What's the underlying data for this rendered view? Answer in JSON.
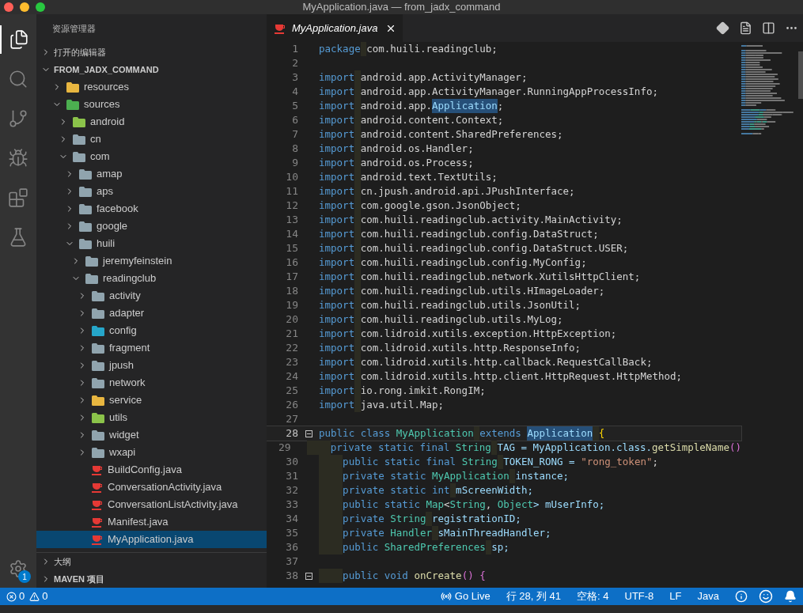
{
  "window": {
    "title": "MyApplication.java — from_jadx_command"
  },
  "activity_bar": {
    "items": [
      {
        "kind": "files",
        "selected": true
      },
      {
        "kind": "search",
        "selected": false
      },
      {
        "kind": "git",
        "selected": false
      },
      {
        "kind": "debug",
        "selected": false
      },
      {
        "kind": "extensions",
        "selected": false
      },
      {
        "kind": "flask",
        "selected": false
      }
    ],
    "settings_badge": "1"
  },
  "sidebar": {
    "title": "资源管理器",
    "sections": [
      {
        "label": "打开的编辑器",
        "expanded": false,
        "bold": false
      },
      {
        "label": "FROM_JADX_COMMAND",
        "expanded": true,
        "bold": true
      }
    ],
    "tree": [
      {
        "kind": "folder",
        "label": "resources",
        "color": "#e8b640",
        "expanded": false,
        "selected": false
      },
      {
        "kind": "folder",
        "label": "sources",
        "color": "#4caf50",
        "expanded": true,
        "selected": false,
        "children": [
          {
            "kind": "folder",
            "label": "android",
            "color": "#8bc34a",
            "expanded": false,
            "selected": false
          },
          {
            "kind": "folder",
            "label": "cn",
            "color": "#90a4ae",
            "expanded": false,
            "selected": false
          },
          {
            "kind": "folder",
            "label": "com",
            "color": "#90a4ae",
            "expanded": true,
            "selected": false,
            "children": [
              {
                "kind": "folder",
                "label": "amap",
                "color": "#90a4ae",
                "expanded": false,
                "selected": false
              },
              {
                "kind": "folder",
                "label": "aps",
                "color": "#90a4ae",
                "expanded": false,
                "selected": false
              },
              {
                "kind": "folder",
                "label": "facebook",
                "color": "#90a4ae",
                "expanded": false,
                "selected": false
              },
              {
                "kind": "folder",
                "label": "google",
                "color": "#90a4ae",
                "expanded": false,
                "selected": false
              },
              {
                "kind": "folder",
                "label": "huili",
                "color": "#90a4ae",
                "expanded": true,
                "selected": false,
                "children": [
                  {
                    "kind": "folder",
                    "label": "jeremyfeinstein",
                    "color": "#90a4ae",
                    "expanded": false,
                    "selected": false
                  },
                  {
                    "kind": "folder",
                    "label": "readingclub",
                    "color": "#90a4ae",
                    "expanded": true,
                    "selected": false,
                    "children": [
                      {
                        "kind": "folder",
                        "label": "activity",
                        "color": "#90a4ae",
                        "expanded": false,
                        "selected": false
                      },
                      {
                        "kind": "folder",
                        "label": "adapter",
                        "color": "#90a4ae",
                        "expanded": false,
                        "selected": false
                      },
                      {
                        "kind": "folder",
                        "label": "config",
                        "color": "#26a6c9",
                        "expanded": false,
                        "selected": false
                      },
                      {
                        "kind": "folder",
                        "label": "fragment",
                        "color": "#90a4ae",
                        "expanded": false,
                        "selected": false
                      },
                      {
                        "kind": "folder",
                        "label": "jpush",
                        "color": "#90a4ae",
                        "expanded": false,
                        "selected": false
                      },
                      {
                        "kind": "folder",
                        "label": "network",
                        "color": "#90a4ae",
                        "expanded": false,
                        "selected": false
                      },
                      {
                        "kind": "folder",
                        "label": "service",
                        "color": "#e8b640",
                        "expanded": false,
                        "selected": false
                      },
                      {
                        "kind": "folder",
                        "label": "utils",
                        "color": "#8bc34a",
                        "expanded": false,
                        "selected": false
                      },
                      {
                        "kind": "folder",
                        "label": "widget",
                        "color": "#90a4ae",
                        "expanded": false,
                        "selected": false
                      },
                      {
                        "kind": "folder",
                        "label": "wxapi",
                        "color": "#90a4ae",
                        "expanded": false,
                        "selected": false
                      },
                      {
                        "kind": "file",
                        "label": "BuildConfig.java",
                        "selected": false
                      },
                      {
                        "kind": "file",
                        "label": "ConversationActivity.java",
                        "selected": false
                      },
                      {
                        "kind": "file",
                        "label": "ConversationListActivity.java",
                        "selected": false
                      },
                      {
                        "kind": "file",
                        "label": "Manifest.java",
                        "selected": false
                      },
                      {
                        "kind": "file",
                        "label": "MyApplication.java",
                        "selected": true
                      }
                    ]
                  }
                ]
              }
            ]
          }
        ]
      }
    ],
    "bottom_sections": [
      {
        "label": "大纲",
        "expanded": false
      },
      {
        "label": "MAVEN 项目",
        "expanded": false
      }
    ]
  },
  "tabs": [
    {
      "label": "MyApplication.java",
      "selected": true
    }
  ],
  "editor": {
    "lines": [
      {
        "number": "1",
        "foldable": false,
        "current": false,
        "tokens": [
          {
            "kind": "kw",
            "text": "package"
          },
          {
            "kind": "plain",
            "text": " com.huili.readingclub;"
          }
        ]
      },
      {
        "number": "2",
        "foldable": false,
        "current": false
      },
      {
        "number": "3",
        "foldable": false,
        "current": false,
        "tokens": [
          {
            "kind": "kw",
            "text": "import"
          },
          {
            "kind": "plain",
            "text": " android.app.ActivityManager;"
          }
        ]
      },
      {
        "number": "4",
        "foldable": false,
        "current": false,
        "tokens": [
          {
            "kind": "kw",
            "text": "import"
          },
          {
            "kind": "plain",
            "text": " android.app.ActivityManager.RunningAppProcessInfo;"
          }
        ]
      },
      {
        "number": "5",
        "foldable": false,
        "current": false,
        "tokens": [
          {
            "kind": "kw",
            "text": "import"
          },
          {
            "kind": "plain",
            "text": " android.app."
          },
          {
            "kind": "match",
            "text": "Application"
          },
          {
            "kind": "plain",
            "text": ";"
          }
        ]
      },
      {
        "number": "6",
        "foldable": false,
        "current": false,
        "tokens": [
          {
            "kind": "kw",
            "text": "import"
          },
          {
            "kind": "plain",
            "text": " android.content.Context;"
          }
        ]
      },
      {
        "number": "7",
        "foldable": false,
        "current": false,
        "tokens": [
          {
            "kind": "kw",
            "text": "import"
          },
          {
            "kind": "plain",
            "text": " android.content.SharedPreferences;"
          }
        ]
      },
      {
        "number": "8",
        "foldable": false,
        "current": false,
        "tokens": [
          {
            "kind": "kw",
            "text": "import"
          },
          {
            "kind": "plain",
            "text": " android.os.Handler;"
          }
        ]
      },
      {
        "number": "9",
        "foldable": false,
        "current": false,
        "tokens": [
          {
            "kind": "kw",
            "text": "import"
          },
          {
            "kind": "plain",
            "text": " android.os.Process;"
          }
        ]
      },
      {
        "number": "10",
        "foldable": false,
        "current": false,
        "tokens": [
          {
            "kind": "kw",
            "text": "import"
          },
          {
            "kind": "plain",
            "text": " android.text.TextUtils;"
          }
        ]
      },
      {
        "number": "11",
        "foldable": false,
        "current": false,
        "tokens": [
          {
            "kind": "kw",
            "text": "import"
          },
          {
            "kind": "plain",
            "text": " cn.jpush.android.api.JPushInterface;"
          }
        ]
      },
      {
        "number": "12",
        "foldable": false,
        "current": false,
        "tokens": [
          {
            "kind": "kw",
            "text": "import"
          },
          {
            "kind": "plain",
            "text": " com.google.gson.JsonObject;"
          }
        ]
      },
      {
        "number": "13",
        "foldable": false,
        "current": false,
        "tokens": [
          {
            "kind": "kw",
            "text": "import"
          },
          {
            "kind": "plain",
            "text": " com.huili.readingclub.activity.MainActivity;"
          }
        ]
      },
      {
        "number": "14",
        "foldable": false,
        "current": false,
        "tokens": [
          {
            "kind": "kw",
            "text": "import"
          },
          {
            "kind": "plain",
            "text": " com.huili.readingclub.config.DataStruct;"
          }
        ]
      },
      {
        "number": "15",
        "foldable": false,
        "current": false,
        "tokens": [
          {
            "kind": "kw",
            "text": "import"
          },
          {
            "kind": "plain",
            "text": " com.huili.readingclub.config.DataStruct.USER;"
          }
        ]
      },
      {
        "number": "16",
        "foldable": false,
        "current": false,
        "tokens": [
          {
            "kind": "kw",
            "text": "import"
          },
          {
            "kind": "plain",
            "text": " com.huili.readingclub.config.MyConfig;"
          }
        ]
      },
      {
        "number": "17",
        "foldable": false,
        "current": false,
        "tokens": [
          {
            "kind": "kw",
            "text": "import"
          },
          {
            "kind": "plain",
            "text": " com.huili.readingclub.network.XutilsHttpClient;"
          }
        ]
      },
      {
        "number": "18",
        "foldable": false,
        "current": false,
        "tokens": [
          {
            "kind": "kw",
            "text": "import"
          },
          {
            "kind": "plain",
            "text": " com.huili.readingclub.utils.HImageLoader;"
          }
        ]
      },
      {
        "number": "19",
        "foldable": false,
        "current": false,
        "tokens": [
          {
            "kind": "kw",
            "text": "import"
          },
          {
            "kind": "plain",
            "text": " com.huili.readingclub.utils.JsonUtil;"
          }
        ]
      },
      {
        "number": "20",
        "foldable": false,
        "current": false,
        "tokens": [
          {
            "kind": "kw",
            "text": "import"
          },
          {
            "kind": "plain",
            "text": " com.huili.readingclub.utils.MyLog;"
          }
        ]
      },
      {
        "number": "21",
        "foldable": false,
        "current": false,
        "tokens": [
          {
            "kind": "kw",
            "text": "import"
          },
          {
            "kind": "plain",
            "text": " com.lidroid.xutils.exception.HttpException;"
          }
        ]
      },
      {
        "number": "22",
        "foldable": false,
        "current": false,
        "tokens": [
          {
            "kind": "kw",
            "text": "import"
          },
          {
            "kind": "plain",
            "text": " com.lidroid.xutils.http.ResponseInfo;"
          }
        ]
      },
      {
        "number": "23",
        "foldable": false,
        "current": false,
        "tokens": [
          {
            "kind": "kw",
            "text": "import"
          },
          {
            "kind": "plain",
            "text": " com.lidroid.xutils.http.callback.RequestCallBack;"
          }
        ]
      },
      {
        "number": "24",
        "foldable": false,
        "current": false,
        "tokens": [
          {
            "kind": "kw",
            "text": "import"
          },
          {
            "kind": "plain",
            "text": " com.lidroid.xutils.http.client.HttpRequest.HttpMethod;"
          }
        ]
      },
      {
        "number": "25",
        "foldable": false,
        "current": false,
        "tokens": [
          {
            "kind": "kw",
            "text": "import"
          },
          {
            "kind": "plain",
            "text": " io.rong.imkit.RongIM;"
          }
        ]
      },
      {
        "number": "26",
        "foldable": false,
        "current": false,
        "tokens": [
          {
            "kind": "kw",
            "text": "import"
          },
          {
            "kind": "plain",
            "text": " java.util.Map;"
          }
        ]
      },
      {
        "number": "27",
        "foldable": false,
        "current": false
      },
      {
        "number": "28",
        "foldable": true,
        "current": true,
        "tokens": [
          {
            "kind": "kw",
            "text": "public class "
          },
          {
            "kind": "type",
            "text": "MyApplication"
          },
          {
            "kind": "kw",
            "text": " extends "
          },
          {
            "kind": "match",
            "text": "Application"
          },
          {
            "kind": "brace",
            "text": " {"
          }
        ]
      },
      {
        "number": "29",
        "foldable": false,
        "current": false,
        "tokens": [
          {
            "kind": "kw",
            "text": "    private static final "
          },
          {
            "kind": "type",
            "text": "String"
          },
          {
            "kind": "var",
            "text": " TAG = MyApplication.class."
          },
          {
            "kind": "fn",
            "text": "getSimpleName"
          },
          {
            "kind": "paren",
            "text": "()"
          }
        ]
      },
      {
        "number": "30",
        "foldable": false,
        "current": false,
        "tokens": [
          {
            "kind": "kw",
            "text": "    public static final "
          },
          {
            "kind": "type",
            "text": "String"
          },
          {
            "kind": "var",
            "text": " TOKEN_RONG = "
          },
          {
            "kind": "str",
            "text": "\"rong_token\""
          },
          {
            "kind": "plain",
            "text": ";"
          }
        ]
      },
      {
        "number": "31",
        "foldable": false,
        "current": false,
        "tokens": [
          {
            "kind": "kw",
            "text": "    private static "
          },
          {
            "kind": "type",
            "text": "MyApplication"
          },
          {
            "kind": "var",
            "text": " instance;"
          }
        ]
      },
      {
        "number": "32",
        "foldable": false,
        "current": false,
        "tokens": [
          {
            "kind": "kw",
            "text": "    private static int"
          },
          {
            "kind": "var",
            "text": " mScreenWidth;"
          }
        ]
      },
      {
        "number": "33",
        "foldable": false,
        "current": false,
        "tokens": [
          {
            "kind": "kw",
            "text": "    public static "
          },
          {
            "kind": "type",
            "text": "Map"
          },
          {
            "kind": "plain",
            "text": "<"
          },
          {
            "kind": "type",
            "text": "String"
          },
          {
            "kind": "plain",
            "text": ", "
          },
          {
            "kind": "type",
            "text": "Object"
          },
          {
            "kind": "var",
            "text": "> mUserInfo;"
          }
        ]
      },
      {
        "number": "34",
        "foldable": false,
        "current": false,
        "tokens": [
          {
            "kind": "kw",
            "text": "    private "
          },
          {
            "kind": "type",
            "text": "String"
          },
          {
            "kind": "var",
            "text": " registrationID;"
          }
        ]
      },
      {
        "number": "35",
        "foldable": false,
        "current": false,
        "tokens": [
          {
            "kind": "kw",
            "text": "    private "
          },
          {
            "kind": "type",
            "text": "Handler"
          },
          {
            "kind": "var",
            "text": " sMainThreadHandler;"
          }
        ]
      },
      {
        "number": "36",
        "foldable": false,
        "current": false,
        "tokens": [
          {
            "kind": "kw",
            "text": "    public "
          },
          {
            "kind": "type",
            "text": "SharedPreferences"
          },
          {
            "kind": "var",
            "text": " sp;"
          }
        ]
      },
      {
        "number": "37",
        "foldable": false,
        "current": false
      },
      {
        "number": "38",
        "foldable": true,
        "current": false,
        "tokens": [
          {
            "kind": "kw",
            "text": "    public void "
          },
          {
            "kind": "fn",
            "text": "onCreate"
          },
          {
            "kind": "paren",
            "text": "() {"
          }
        ]
      }
    ]
  },
  "status_bar": {
    "errors": "0",
    "warnings": "0",
    "items": [
      {
        "kind": "live",
        "text": "Go Live"
      },
      {
        "kind": "text",
        "text": "行 28, 列 41"
      },
      {
        "kind": "text",
        "text": "空格: 4"
      },
      {
        "kind": "text",
        "text": "UTF-8"
      },
      {
        "kind": "text",
        "text": "LF"
      },
      {
        "kind": "text",
        "text": "Java"
      }
    ]
  }
}
